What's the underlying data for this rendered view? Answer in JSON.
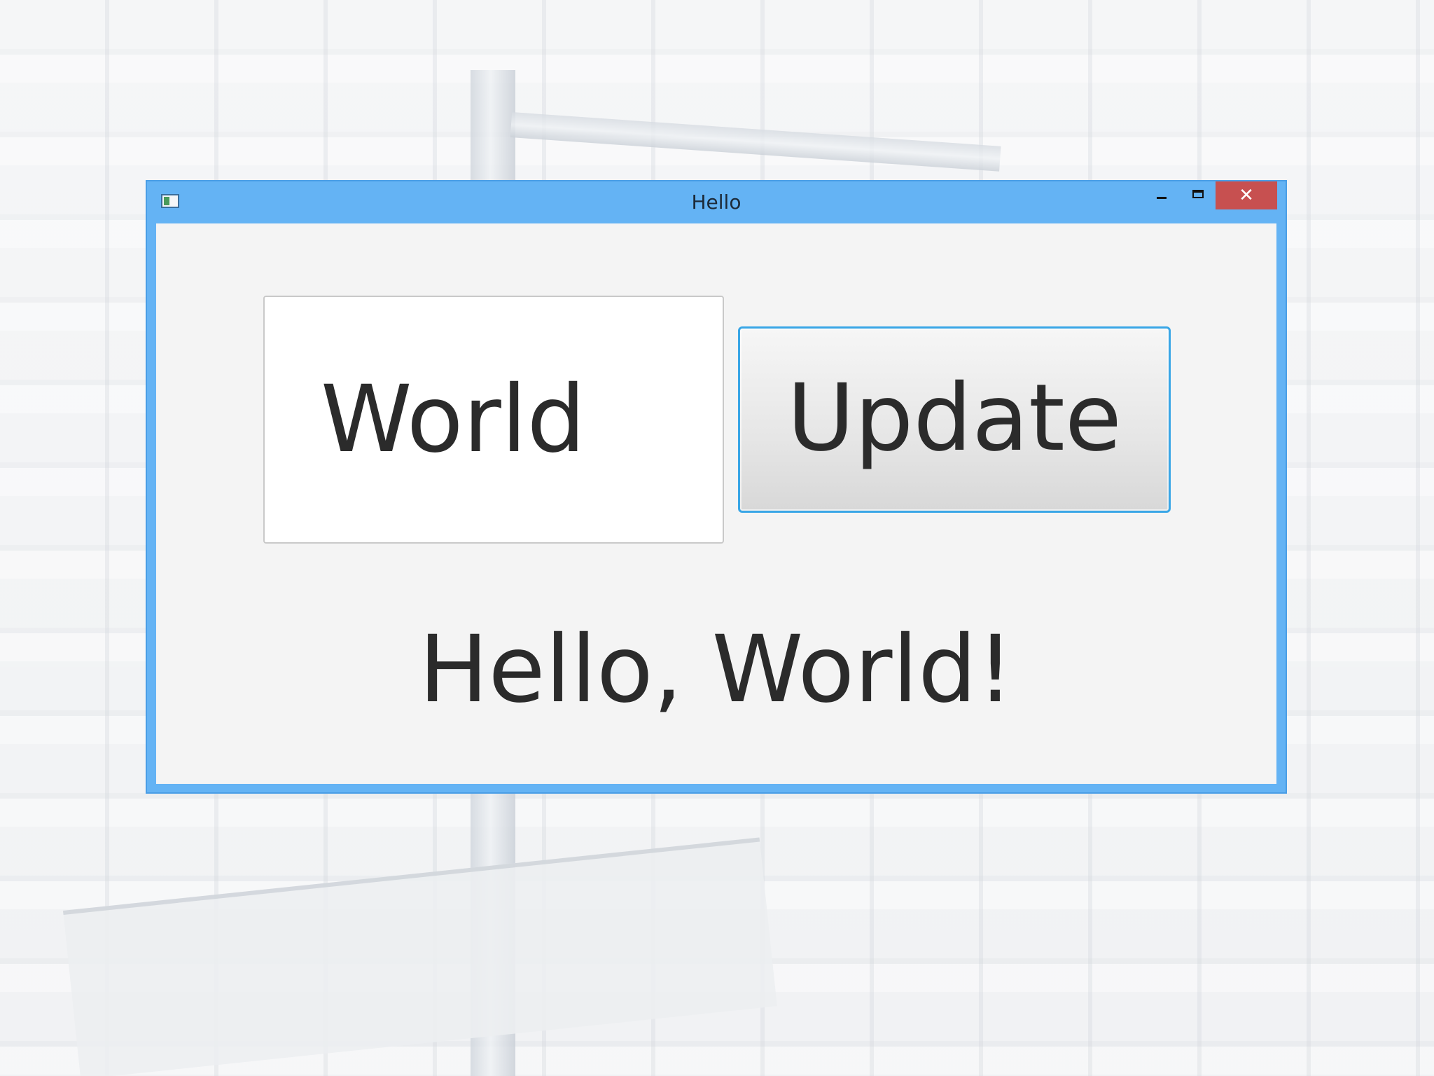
{
  "window": {
    "title": "Hello",
    "close_glyph": "✕",
    "icons": [
      "app-window-icon",
      "minimize-icon",
      "maximize-icon",
      "close-icon"
    ]
  },
  "form": {
    "name_input_value": "World",
    "update_button_label": "Update",
    "greeting_text": "Hello, World!"
  },
  "colors": {
    "titlebar": "#64b3f4",
    "close_button": "#c75050",
    "button_focus_border": "#39a6e6",
    "client_background": "#f4f4f4"
  }
}
